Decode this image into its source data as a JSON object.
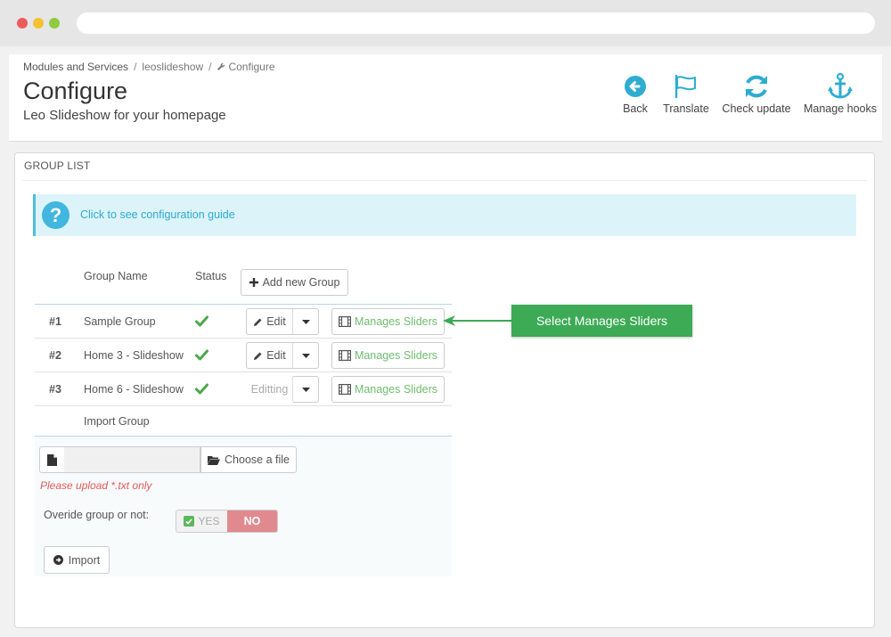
{
  "breadcrumb": {
    "items": [
      "Modules and Services",
      "leoslideshow",
      "Configure"
    ],
    "separator": "/"
  },
  "header": {
    "title": "Configure",
    "subtitle": "Leo Slideshow for your homepage"
  },
  "toolbar": {
    "back_label": "Back",
    "translate_label": "Translate",
    "check_update_label": "Check update",
    "manage_hooks_label": "Manage hooks",
    "icon_color": "#2eacd1"
  },
  "panel": {
    "heading": "GROUP LIST",
    "guide_link": "Click to see configuration guide"
  },
  "table": {
    "headers": {
      "group_name": "Group Name",
      "status": "Status"
    },
    "add_group_label": "Add new Group",
    "rows": [
      {
        "num": "#1",
        "name": "Sample Group",
        "edit_label": "Edit",
        "manage_label": "Manages Sliders"
      },
      {
        "num": "#2",
        "name": "Home 3 - Slideshow",
        "edit_label": "Edit",
        "manage_label": "Manages Sliders"
      },
      {
        "num": "#3",
        "name": "Home 6 - Slideshow",
        "edit_label": "Editting",
        "manage_label": "Manages Sliders"
      }
    ],
    "import_group_label": "Import Group"
  },
  "import": {
    "choose_label": "Choose a file",
    "file_value": "",
    "upload_hint": "Please upload *.txt only",
    "override_label": "Overide group or not:",
    "toggle_yes": "YES",
    "toggle_no": "NO",
    "import_label": "Import"
  },
  "callout": {
    "text": "Select Manages Sliders",
    "color": "#3daa55"
  }
}
